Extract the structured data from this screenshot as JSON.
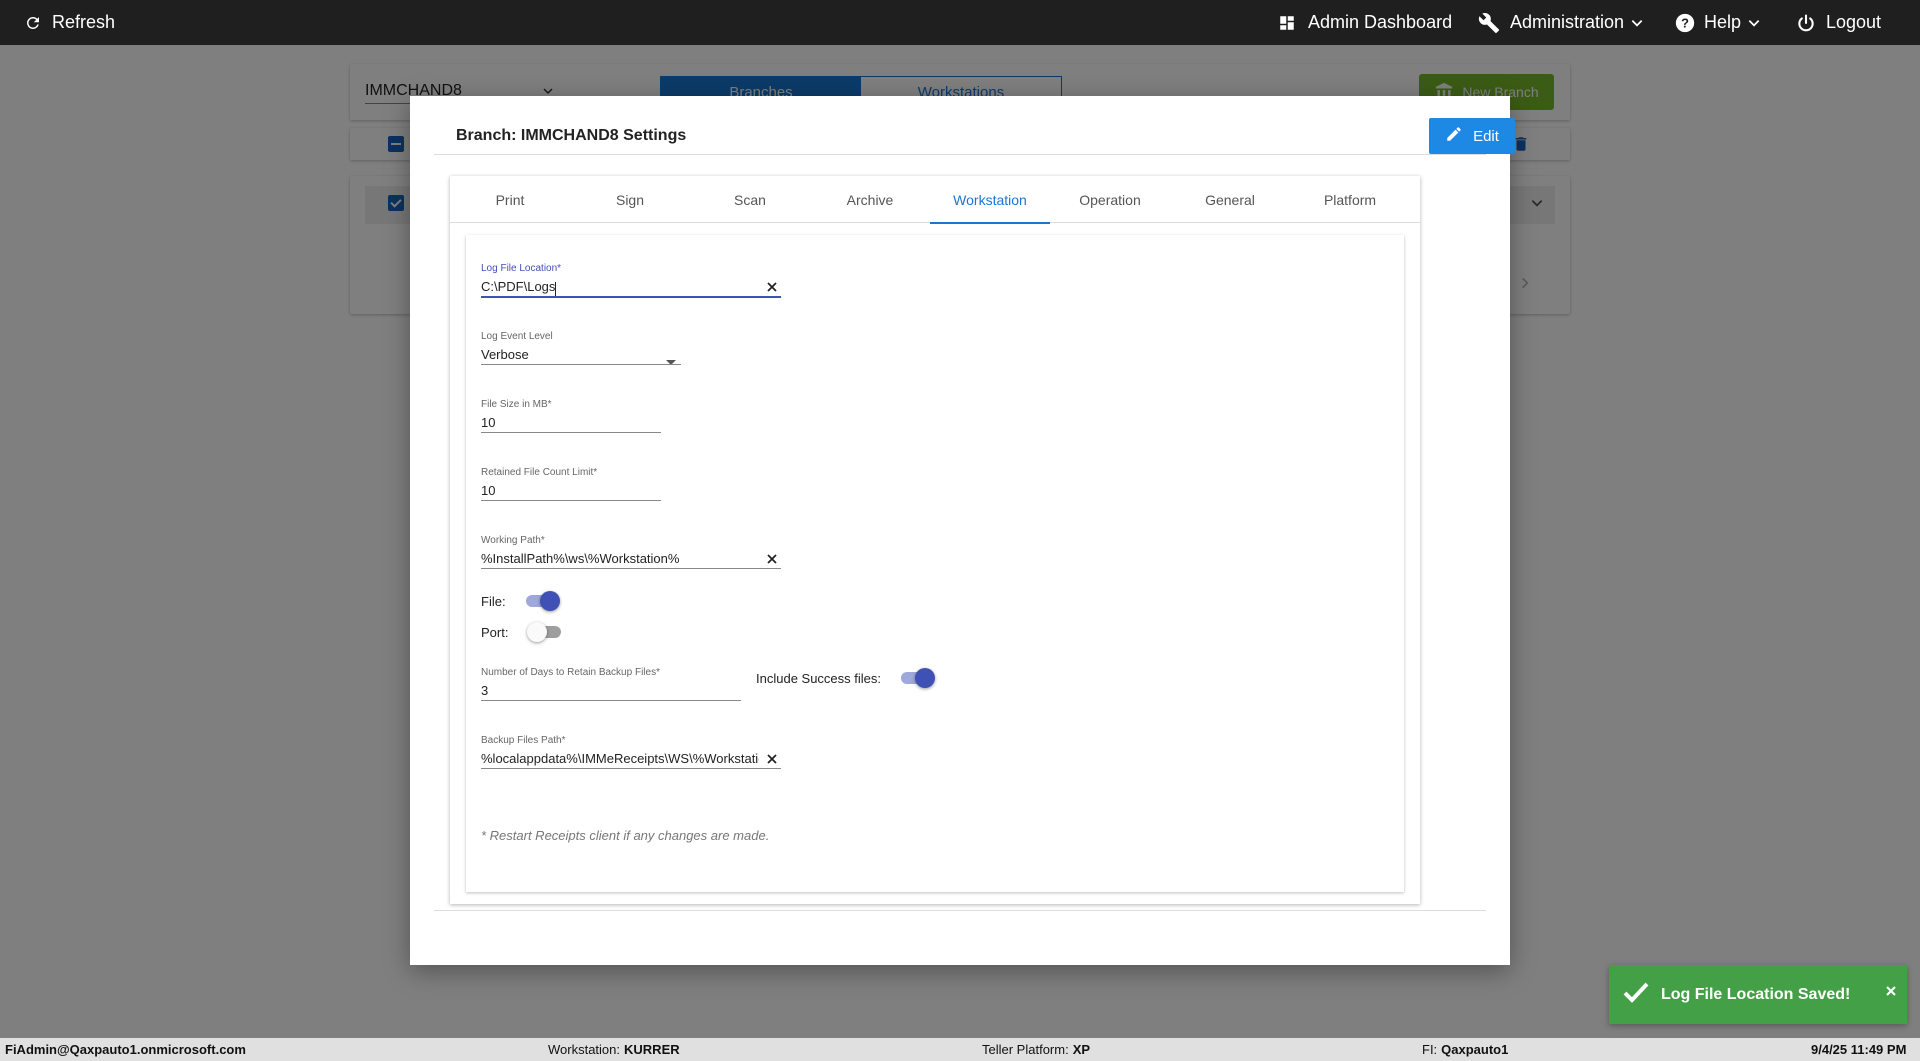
{
  "topbar": {
    "refresh": "Refresh",
    "admin_dashboard": "Admin Dashboard",
    "administration": "Administration",
    "help": "Help",
    "logout": "Logout"
  },
  "background": {
    "branch_select": "IMMCHAND8",
    "tabs": [
      "Branches",
      "Workstations"
    ],
    "new_branch": "New Branch"
  },
  "modal": {
    "title": "Branch: IMMCHAND8 Settings",
    "edit_label": "Edit",
    "tabs": [
      "Print",
      "Sign",
      "Scan",
      "Archive",
      "Workstation",
      "Operation",
      "General",
      "Platform"
    ],
    "active_tab": "Workstation",
    "fields": {
      "log_file_location": {
        "label": "Log File Location",
        "required": "*",
        "value": "C:\\PDF\\Logs"
      },
      "log_event_level": {
        "label": "Log Event Level",
        "value": "Verbose"
      },
      "file_size": {
        "label": "File Size in MB*",
        "value": "10"
      },
      "retained_count": {
        "label": "Retained File Count Limit*",
        "value": "10"
      },
      "working_path": {
        "label": "Working Path*",
        "value": "%InstallPath%\\ws\\%Workstation%"
      },
      "retain_days": {
        "label": "Number of Days to Retain Backup Files*",
        "value": "3"
      },
      "backup_path": {
        "label": "Backup Files Path*",
        "value": "%localappdata%\\IMMeReceipts\\WS\\%Workstation%"
      }
    },
    "toggles": {
      "file": {
        "label": "File:",
        "on": true
      },
      "port": {
        "label": "Port:",
        "on": false
      },
      "include_success": {
        "label": "Include Success files:",
        "on": true
      }
    },
    "note": "* Restart Receipts client if any changes are made."
  },
  "toast": {
    "message": "Log File Location Saved!",
    "close": "×"
  },
  "statusbar": {
    "user": "FiAdmin@Qaxpauto1.onmicrosoft.com",
    "workstation_label": "Workstation:",
    "workstation": "KURRER",
    "platform_label": "Teller Platform:",
    "platform": "XP",
    "fi_label": "FI:",
    "fi": "Qaxpauto1",
    "datetime": "9/4/25 11:49 PM"
  },
  "colors": {
    "topbar": "#1f1f1f",
    "primary": "#1976d2",
    "switch_on": "#3f51b5",
    "toast": "#43a047",
    "new_branch": "#76b82a"
  },
  "icons": [
    "refresh-icon",
    "dashboard-icon",
    "wrench-icon",
    "help-icon",
    "power-icon",
    "pencil-icon",
    "clear-icon",
    "check-icon",
    "close-icon"
  ]
}
